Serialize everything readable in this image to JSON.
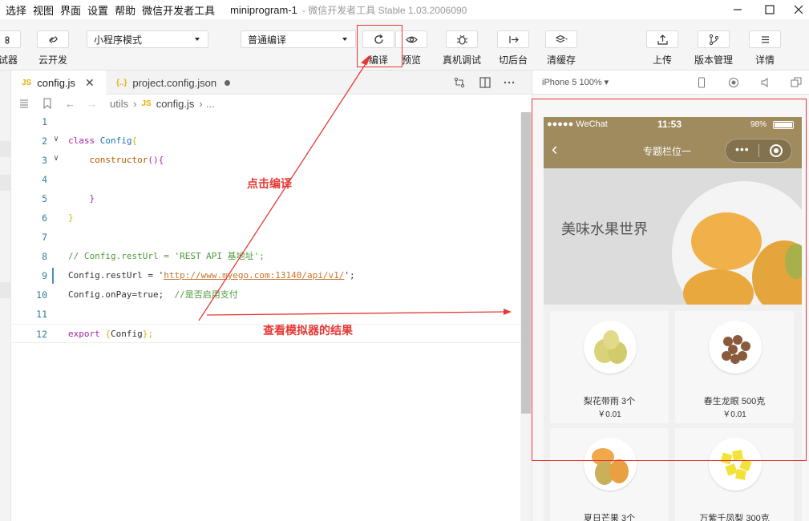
{
  "menubar": {
    "items": [
      "选择",
      "视图",
      "界面",
      "设置",
      "帮助",
      "微信开发者工具"
    ],
    "title": "miniprogram-1",
    "subtitle": "- 微信开发者工具 Stable 1.03.2006090"
  },
  "toolbar": {
    "simulator_label": "试器",
    "cloud_label": "云开发",
    "mode_select": "小程序模式",
    "compile_select": "普通编译",
    "compile_label": "编译",
    "preview_label": "预览",
    "realdevice_label": "真机调试",
    "background_label": "切后台",
    "clearcache_label": "清缓存",
    "upload_label": "上传",
    "version_label": "版本管理",
    "details_label": "详情"
  },
  "tabs": [
    {
      "label": "config.js",
      "icon": "JS"
    },
    {
      "label": "project.config.json",
      "icon": "{..}"
    }
  ],
  "breadcrumb": {
    "folder": "utils",
    "file": "config.js",
    "more": "..."
  },
  "code_lines": [
    {
      "n": "1"
    },
    {
      "n": "2"
    },
    {
      "n": "3"
    },
    {
      "n": "4"
    },
    {
      "n": "5"
    },
    {
      "n": "6"
    },
    {
      "n": "7"
    },
    {
      "n": "8"
    },
    {
      "n": "9"
    },
    {
      "n": "10"
    },
    {
      "n": "11"
    },
    {
      "n": "12"
    }
  ],
  "code": {
    "l2_kw": "class",
    "l2_name": "Config",
    "l2_brace": "{",
    "l3_fn": "constructor",
    "l3_paren": "(){",
    "l5_brace": "}",
    "l6_brace": "}",
    "l8_comment": "// Config.restUrl = 'REST API 基地址';",
    "l9_prefix": "Config.restUrl = '",
    "l9_url": "http://www.myego.com:13140/api/v1/",
    "l9_suffix": "';",
    "l10_prefix": "Config.onPay=true;",
    "l10_comment": "//是否启用支付",
    "l12_kw": "export",
    "l12_open": "{",
    "l12_name": "Config",
    "l12_close": "};"
  },
  "simulator": {
    "device": "iPhone 5 100% ▾",
    "status_left": "●●●●● WeChat",
    "status_time": "11:53",
    "status_battery": "98%",
    "nav_title": "专题栏位一",
    "banner_text": "美味水果世界",
    "products": [
      {
        "name": "梨花带雨 3个",
        "price": "￥0.01"
      },
      {
        "name": "春生龙眼 500克",
        "price": "￥0.01"
      },
      {
        "name": "夏日芒果 3个",
        "price": ""
      },
      {
        "name": "万紫千凤梨 300克",
        "price": ""
      }
    ]
  },
  "annotations": {
    "click_compile": "点击编译",
    "view_result": "查看模拟器的结果"
  },
  "colors": {
    "annotation_red": "#e53935",
    "nav_bar": "#a08b5f"
  }
}
